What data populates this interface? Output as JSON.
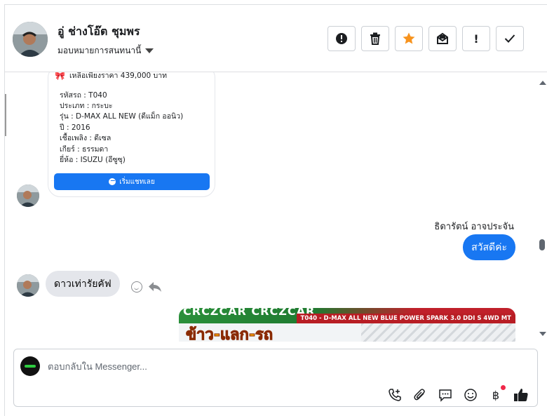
{
  "header": {
    "contact_name": "อู่ ช่างโอ๊ต ชุมพร",
    "assign_label": "มอบหมายการสนทนานี้",
    "actions": [
      {
        "name": "report-spam-button",
        "glyph": "!",
        "style": "alert-circle"
      },
      {
        "name": "delete-button",
        "glyph": "trash"
      },
      {
        "name": "star-button",
        "glyph": "★",
        "color": "#f7931e"
      },
      {
        "name": "mark-unread-button",
        "glyph": "envelope"
      },
      {
        "name": "mark-follow-up-button",
        "glyph": "!"
      },
      {
        "name": "mark-done-button",
        "glyph": "✓"
      }
    ]
  },
  "card": {
    "price": "เหลือเพียงราคา 439,000 บาท",
    "lines": [
      "รหัสรถ : T040",
      "ประเภท : กระบะ",
      "รุ่น : D-MAX ALL NEW (ดีแม็ก ออนิว)",
      "ปี : 2016",
      "เชื้อเพลิง : ดีเซล",
      "เกียร์ : ธรรมดา",
      "ยี่ห้อ : ISUZU (อีซูซุ)"
    ],
    "button_label": "เริ่มแชทเลย"
  },
  "thread": {
    "sender_name": "ธิดารัตน์ อาจประจัน",
    "outgoing_message": "สวัสดีค่ะ",
    "incoming_message": "ดาวเท่ารัยคัฟ"
  },
  "promo": {
    "header_text": "CRCZCAR CRCZCAR",
    "strip_text": "T040 - D-MAX ALL NEW BLUE POWER SPARK 3.0 DDI S 4WD MT",
    "headline": "ข้าว-แลก-รถ"
  },
  "composer": {
    "placeholder": "ตอบกลับใน Messenger...",
    "tools": [
      "add-call-icon",
      "attachment-icon",
      "saved-replies-icon",
      "emoji-icon",
      "payment-icon",
      "like-icon"
    ],
    "accent": "#1877f2"
  }
}
